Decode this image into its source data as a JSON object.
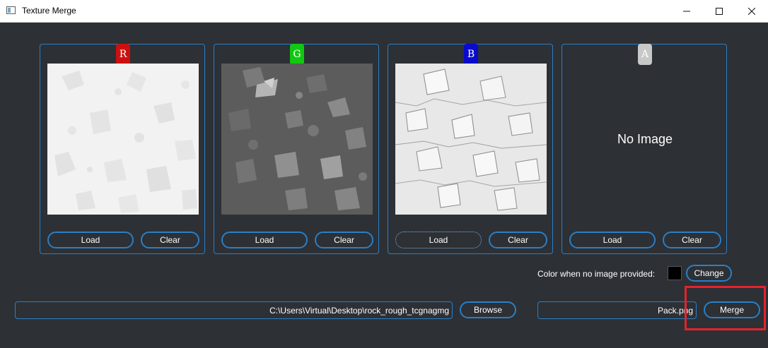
{
  "window": {
    "title": "Texture Merge",
    "controls": [
      "minimize",
      "maximize",
      "close"
    ]
  },
  "channels": [
    {
      "badge": "R",
      "color": "#cc1010",
      "has_image": true,
      "load_label": "Load",
      "clear_label": "Clear"
    },
    {
      "badge": "G",
      "color": "#11c811",
      "has_image": true,
      "load_label": "Load",
      "clear_label": "Clear"
    },
    {
      "badge": "B",
      "color": "#0a0acc",
      "has_image": true,
      "load_label": "Load",
      "clear_label": "Clear"
    },
    {
      "badge": "A",
      "color": "#c8c8c8",
      "has_image": false,
      "placeholder": "No Image",
      "load_label": "Load",
      "clear_label": "Clear"
    }
  ],
  "default_color": {
    "label": "Color when no image provided:",
    "swatch": "#000000",
    "change_label": "Change"
  },
  "output": {
    "folder_path": "C:\\Users\\Virtual\\Desktop\\rock_rough_tcgnagmg",
    "browse_label": "Browse",
    "filename": "Pack.png",
    "merge_label": "Merge"
  },
  "accent": "#2a7fc7",
  "highlight_color": "#e3232c"
}
